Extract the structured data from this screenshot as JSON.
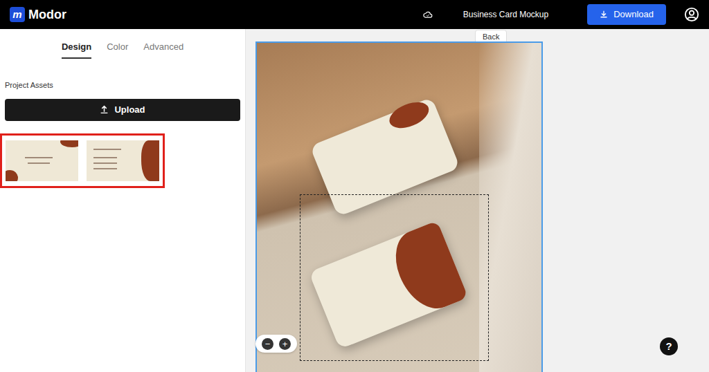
{
  "app": {
    "logo_mark": "m",
    "name": "Modor"
  },
  "topbar": {
    "title": "Business Card Mockup",
    "download": "Download"
  },
  "tabs": [
    {
      "label": "Design",
      "selected": true
    },
    {
      "label": "Color",
      "selected": false
    },
    {
      "label": "Advanced",
      "selected": false
    }
  ],
  "assets": {
    "heading": "Project Assets",
    "upload": "Upload",
    "items": [
      {
        "selected": true
      }
    ]
  },
  "canvas": {
    "back": "Back",
    "zoom_out": "−",
    "zoom_in": "+"
  },
  "help": "?"
}
